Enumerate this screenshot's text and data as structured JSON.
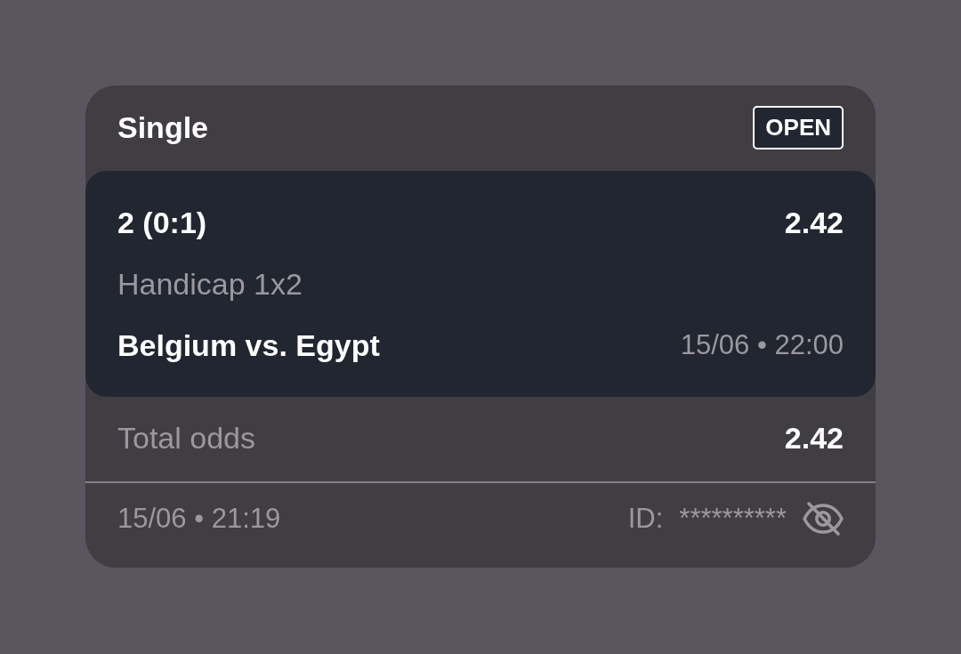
{
  "bet": {
    "type": "Single",
    "status": "OPEN"
  },
  "selection": {
    "pick": "2 (0:1)",
    "odds": "2.42",
    "market": "Handicap 1x2",
    "event": "Belgium vs. Egypt",
    "start": "15/06 • 22:00"
  },
  "total": {
    "label": "Total odds",
    "value": "2.42"
  },
  "footer": {
    "placed": "15/06 • 21:19",
    "id_label": "ID:",
    "id_value": "**********",
    "id_hidden": true
  }
}
